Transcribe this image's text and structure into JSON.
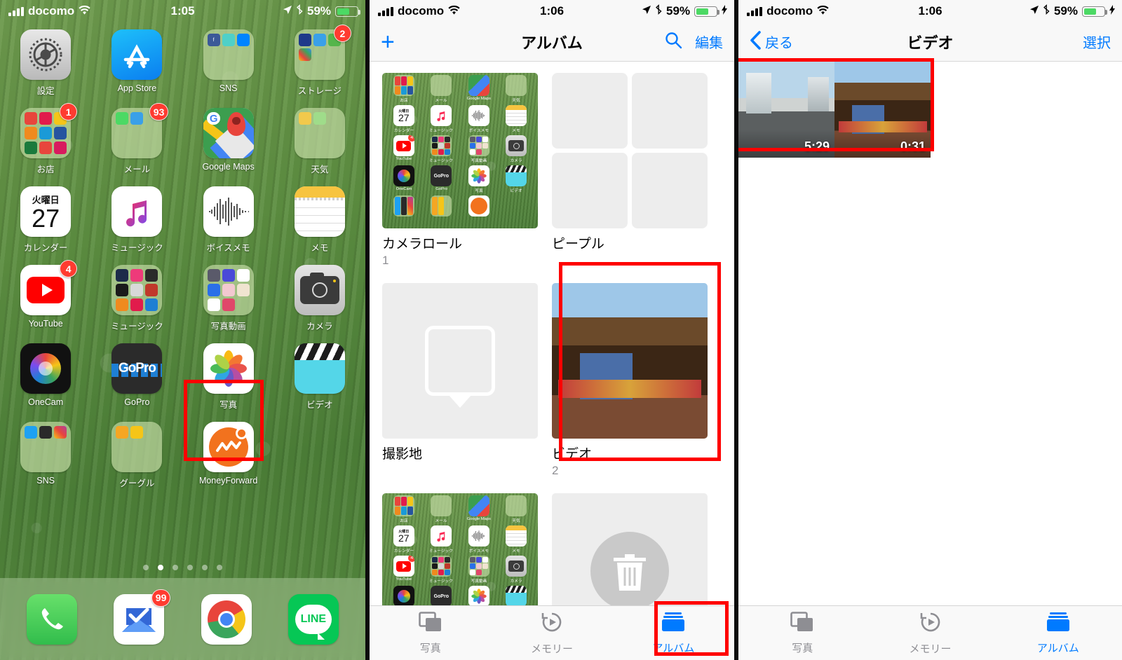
{
  "statusbar": {
    "carrier": "docomo",
    "time_home": "1:05",
    "time_photos": "1:06",
    "battery": "59%",
    "wifi_icon": "wifi-icon",
    "location_icon": "location-arrow-icon",
    "bluetooth_icon": "bluetooth-icon",
    "charging_icon": "lightning-bolt-icon"
  },
  "home": {
    "rows": [
      [
        {
          "label": "設定",
          "icon": "settings-gear-icon",
          "badge": null
        },
        {
          "label": "App Store",
          "icon": "app-store-icon",
          "badge": null
        },
        {
          "label": "SNS",
          "icon": "folder-icon",
          "badge": null
        },
        {
          "label": "ストレージ",
          "icon": "folder-icon",
          "badge": "2"
        }
      ],
      [
        {
          "label": "お店",
          "icon": "folder-icon",
          "badge": "1"
        },
        {
          "label": "メール",
          "icon": "folder-icon",
          "badge": "93"
        },
        {
          "label": "Google Maps",
          "icon": "google-maps-icon",
          "badge": null
        },
        {
          "label": "天気",
          "icon": "folder-icon",
          "badge": null
        }
      ],
      [
        {
          "label": "カレンダー",
          "icon": "calendar-icon",
          "badge": null
        },
        {
          "label": "ミュージック",
          "icon": "apple-music-icon",
          "badge": null
        },
        {
          "label": "ボイスメモ",
          "icon": "voice-memos-icon",
          "badge": null
        },
        {
          "label": "メモ",
          "icon": "notes-icon",
          "badge": null
        }
      ],
      [
        {
          "label": "YouTube",
          "icon": "youtube-icon",
          "badge": "4"
        },
        {
          "label": "ミュージック",
          "icon": "folder-icon",
          "badge": null
        },
        {
          "label": "写真動画",
          "icon": "folder-icon",
          "badge": null
        },
        {
          "label": "カメラ",
          "icon": "camera-icon",
          "badge": null
        }
      ],
      [
        {
          "label": "OneCam",
          "icon": "onecam-icon",
          "badge": null
        },
        {
          "label": "GoPro",
          "icon": "gopro-icon",
          "badge": null
        },
        {
          "label": "写真",
          "icon": "photos-icon",
          "badge": null
        },
        {
          "label": "ビデオ",
          "icon": "videos-clapperboard-icon",
          "badge": null
        }
      ],
      [
        {
          "label": "SNS",
          "icon": "folder-icon",
          "badge": null
        },
        {
          "label": "グーグル",
          "icon": "folder-icon",
          "badge": null
        },
        {
          "label": "MoneyForward",
          "icon": "moneyforward-icon",
          "badge": null
        }
      ]
    ],
    "calendar": {
      "weekday": "火曜日",
      "day": "27"
    },
    "page_dots": 6,
    "active_page": 2,
    "dock": [
      {
        "label": "電話",
        "icon": "phone-icon",
        "badge": null
      },
      {
        "label": "Inbox",
        "icon": "inbox-mail-icon",
        "badge": "99"
      },
      {
        "label": "Chrome",
        "icon": "chrome-icon",
        "badge": null
      },
      {
        "label": "LINE",
        "icon": "line-icon",
        "badge": null
      }
    ]
  },
  "albums_screen": {
    "nav": {
      "add_label": "+",
      "title": "アルバム",
      "search_icon": "search-icon",
      "edit_label": "編集"
    },
    "albums": [
      {
        "title": "カメラロール",
        "count": "1",
        "thumb": "home-screen-screenshot"
      },
      {
        "title": "ピープル",
        "count": "",
        "thumb": "people-placeholder-grid"
      },
      {
        "title": "撮影地",
        "count": "",
        "thumb": "places-map-pin-placeholder"
      },
      {
        "title": "ビデオ",
        "count": "2",
        "thumb": "festival-float-photo"
      },
      {
        "title": "",
        "count": "",
        "thumb": "home-screen-screenshot"
      },
      {
        "title": "",
        "count": "",
        "thumb": "recently-deleted-trash-placeholder"
      }
    ],
    "tabs": [
      {
        "label": "写真",
        "icon": "photos-stack-icon",
        "active": false
      },
      {
        "label": "メモリー",
        "icon": "memories-clock-play-icon",
        "active": false
      },
      {
        "label": "アルバム",
        "icon": "albums-books-icon",
        "active": true
      }
    ]
  },
  "video_screen": {
    "nav": {
      "back_label": "戻る",
      "back_icon": "chevron-left-icon",
      "title": "ビデオ",
      "select_label": "選択"
    },
    "videos": [
      {
        "duration": "5:29",
        "thumb": "dashcam-street-video"
      },
      {
        "duration": "0:31",
        "thumb": "festival-float-video"
      }
    ],
    "tabs": [
      {
        "label": "写真",
        "icon": "photos-stack-icon",
        "active": false
      },
      {
        "label": "メモリー",
        "icon": "memories-clock-play-icon",
        "active": false
      },
      {
        "label": "アルバム",
        "icon": "albums-books-icon",
        "active": true
      }
    ]
  },
  "annotations": {
    "color": "#ff0000",
    "boxes": [
      "photos-app-icon-highlight",
      "videos-album-highlight",
      "albums-tab-highlight",
      "video-thumbnails-highlight"
    ]
  }
}
